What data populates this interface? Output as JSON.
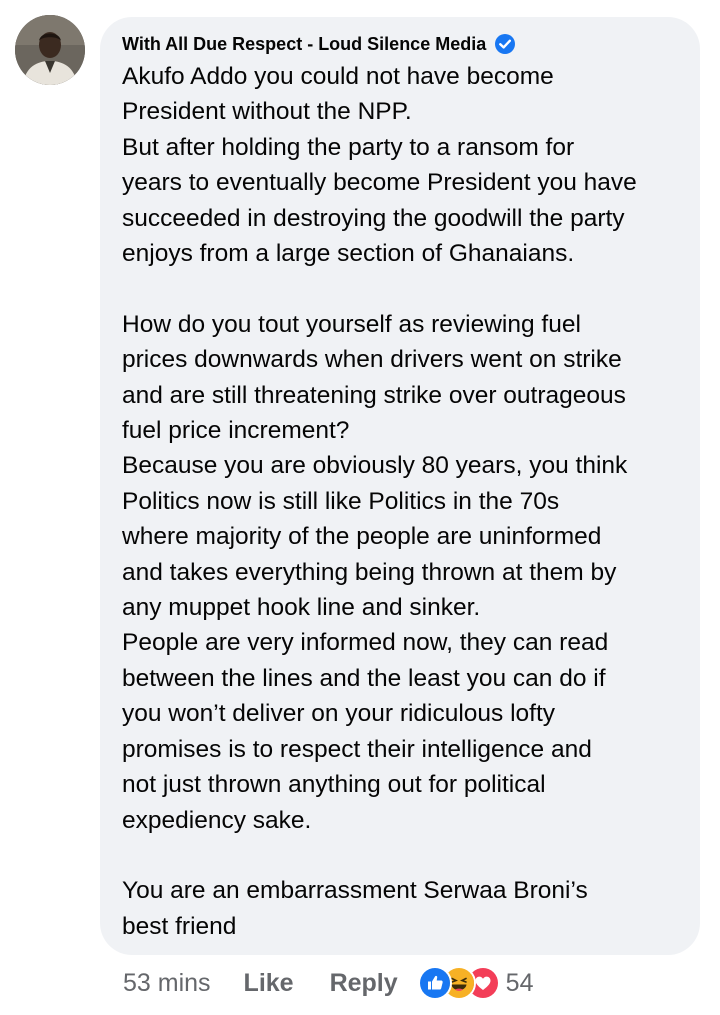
{
  "comment": {
    "author": "With All Due Respect - Loud Silence Media",
    "verified": true,
    "paragraphs": [
      "Akufo Addo you could not have become\nPresident without the NPP.\nBut after holding the party to a ransom for\nyears to eventually become President you have\nsucceeded in destroying the goodwill the party\nenjoys from a large section of Ghanaians.",
      "How do you tout yourself as reviewing fuel\nprices downwards when drivers went on strike\nand are still threatening strike over outrageous\nfuel price increment?\nBecause you are obviously 80 years, you think\nPolitics now is still like Politics in the 70s\nwhere majority of the people are uninformed\nand takes everything being thrown at them by\nany muppet hook line and sinker.\nPeople are very informed now, they can read\nbetween the lines and the least you can do if\nyou won’t deliver on your ridiculous lofty\npromises is to respect their intelligence and\nnot just thrown anything out for political\nexpediency sake.",
      "You are an embarrassment Serwaa Broni’s\nbest friend"
    ]
  },
  "actions": {
    "timestamp": "53 mins",
    "like_label": "Like",
    "reply_label": "Reply"
  },
  "reactions": {
    "icons": [
      "like-icon",
      "haha-icon",
      "love-icon"
    ],
    "count": "54"
  },
  "colors": {
    "bubble_bg": "#f0f2f5",
    "text": "#050505",
    "secondary_text": "#65676b",
    "verified_blue": "#1877f2",
    "like_blue": "#1877f2",
    "haha_yellow": "#f7b125",
    "love_red": "#f33e58"
  }
}
